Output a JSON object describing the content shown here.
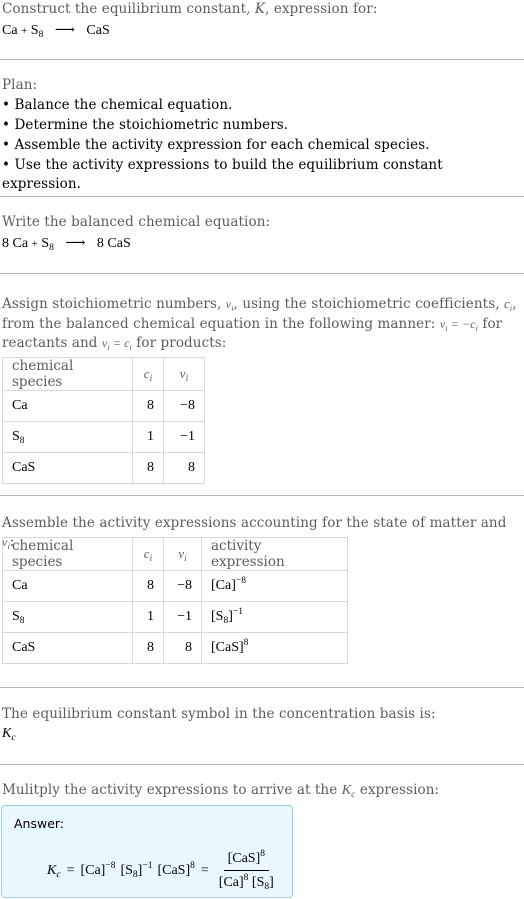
{
  "intro": {
    "heading_pre": "Construct the equilibrium constant, ",
    "heading_k": "K",
    "heading_post": ", expression for:",
    "reaction": {
      "reactant1": "Ca",
      "plus": "+",
      "reactant2": "S",
      "reactant2_sub": "8",
      "arrow": "⟶",
      "product": "CaS"
    }
  },
  "plan": {
    "title": "Plan:",
    "steps": [
      "• Balance the chemical equation.",
      "• Determine the stoichiometric numbers.",
      "• Assemble the activity expression for each chemical species.",
      "• Use the activity expressions to build the equilibrium constant expression."
    ]
  },
  "balanced": {
    "title": "Write the balanced chemical equation:",
    "coef1": "8",
    "reactant1": "Ca",
    "plus": "+",
    "reactant2": "S",
    "reactant2_sub": "8",
    "arrow": "⟶",
    "coef2": "8",
    "product": "CaS"
  },
  "stoich": {
    "text1": "Assign stoichiometric numbers, ",
    "nu": "νi",
    "text2": ", using the stoichiometric coefficients, ",
    "c": "ci",
    "text3": ", from the balanced chemical equation in the following manner: ",
    "rule1": "νi = −ci",
    "text4": " for reactants and ",
    "rule2": "νi = ci",
    "text5": " for products:",
    "headers": [
      "chemical species",
      "c",
      "ν"
    ],
    "header_sub": "i",
    "rows": [
      {
        "species": "Ca",
        "species_sub": "",
        "c": "8",
        "nu": "−8"
      },
      {
        "species": "S",
        "species_sub": "8",
        "c": "1",
        "nu": "−1"
      },
      {
        "species": "CaS",
        "species_sub": "",
        "c": "8",
        "nu": "8"
      }
    ]
  },
  "activity": {
    "text1": "Assemble the activity expressions accounting for the state of matter and ",
    "nu": "νi",
    "text2": ":",
    "headers": [
      "chemical species",
      "c",
      "ν",
      "activity expression"
    ],
    "header_sub": "i",
    "rows": [
      {
        "species": "Ca",
        "species_sub": "",
        "c": "8",
        "nu": "−8",
        "expr_base": "[Ca]",
        "expr_sub": "",
        "expr_close": "",
        "expr_exp": "−8"
      },
      {
        "species": "S",
        "species_sub": "8",
        "c": "1",
        "nu": "−1",
        "expr_base": "[S",
        "expr_sub": "8",
        "expr_close": "]",
        "expr_exp": "−1"
      },
      {
        "species": "CaS",
        "species_sub": "",
        "c": "8",
        "nu": "8",
        "expr_base": "[CaS]",
        "expr_sub": "",
        "expr_close": "",
        "expr_exp": "8"
      }
    ]
  },
  "symbol": {
    "title": "The equilibrium constant symbol in the concentration basis is:",
    "k": "K",
    "k_sub": "c"
  },
  "multiply": {
    "text1": "Mulitply the activity expressions to arrive at the ",
    "k": "K",
    "k_sub": "c",
    "text2": " expression:"
  },
  "answer": {
    "label": "Answer:",
    "k": "K",
    "k_sub": "c",
    "eq": "=",
    "t1": "[Ca]",
    "t1_exp": "−8",
    "t2_open": "[S",
    "t2_sub": "8",
    "t2_close": "]",
    "t2_exp": "−1",
    "t3": "[CaS]",
    "t3_exp": "8",
    "eq2": "=",
    "num": "[CaS]",
    "num_exp": "8",
    "den1": "[Ca]",
    "den1_exp": "8",
    "den2_open": "[S",
    "den2_sub": "8",
    "den2_close": "]"
  },
  "colors": {
    "answer_bg": "#e9f8fe",
    "answer_border": "#95d0e2",
    "divider": "#b4b4b4",
    "muted_text": "#5c5c5c"
  }
}
